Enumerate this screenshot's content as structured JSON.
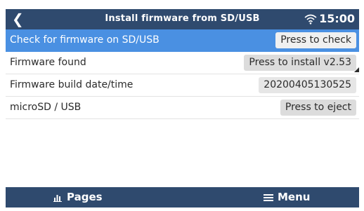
{
  "header": {
    "back_icon": "back-arrow-icon",
    "title": "Install firmware from SD/USB",
    "wifi_icon": "wifi-icon",
    "time": "15:00"
  },
  "rows": [
    {
      "label": "Check for firmware on SD/USB",
      "action": "Press to check",
      "selected": true
    },
    {
      "label": "Firmware found",
      "action": "Press to install v2.53",
      "selected": false
    },
    {
      "label": "Firmware build date/time",
      "value": "20200405130525",
      "selected": false
    },
    {
      "label": "microSD / USB",
      "action": "Press to eject",
      "selected": false
    }
  ],
  "footer": {
    "pages_label": "Pages",
    "pages_icon": "bar-chart-icon",
    "menu_label": "Menu",
    "menu_icon": "hamburger-menu-icon"
  },
  "colors": {
    "header_bg": "#2f4a6e",
    "selected_bg": "#4a90e2",
    "button_bg": "#dcdcdc"
  }
}
